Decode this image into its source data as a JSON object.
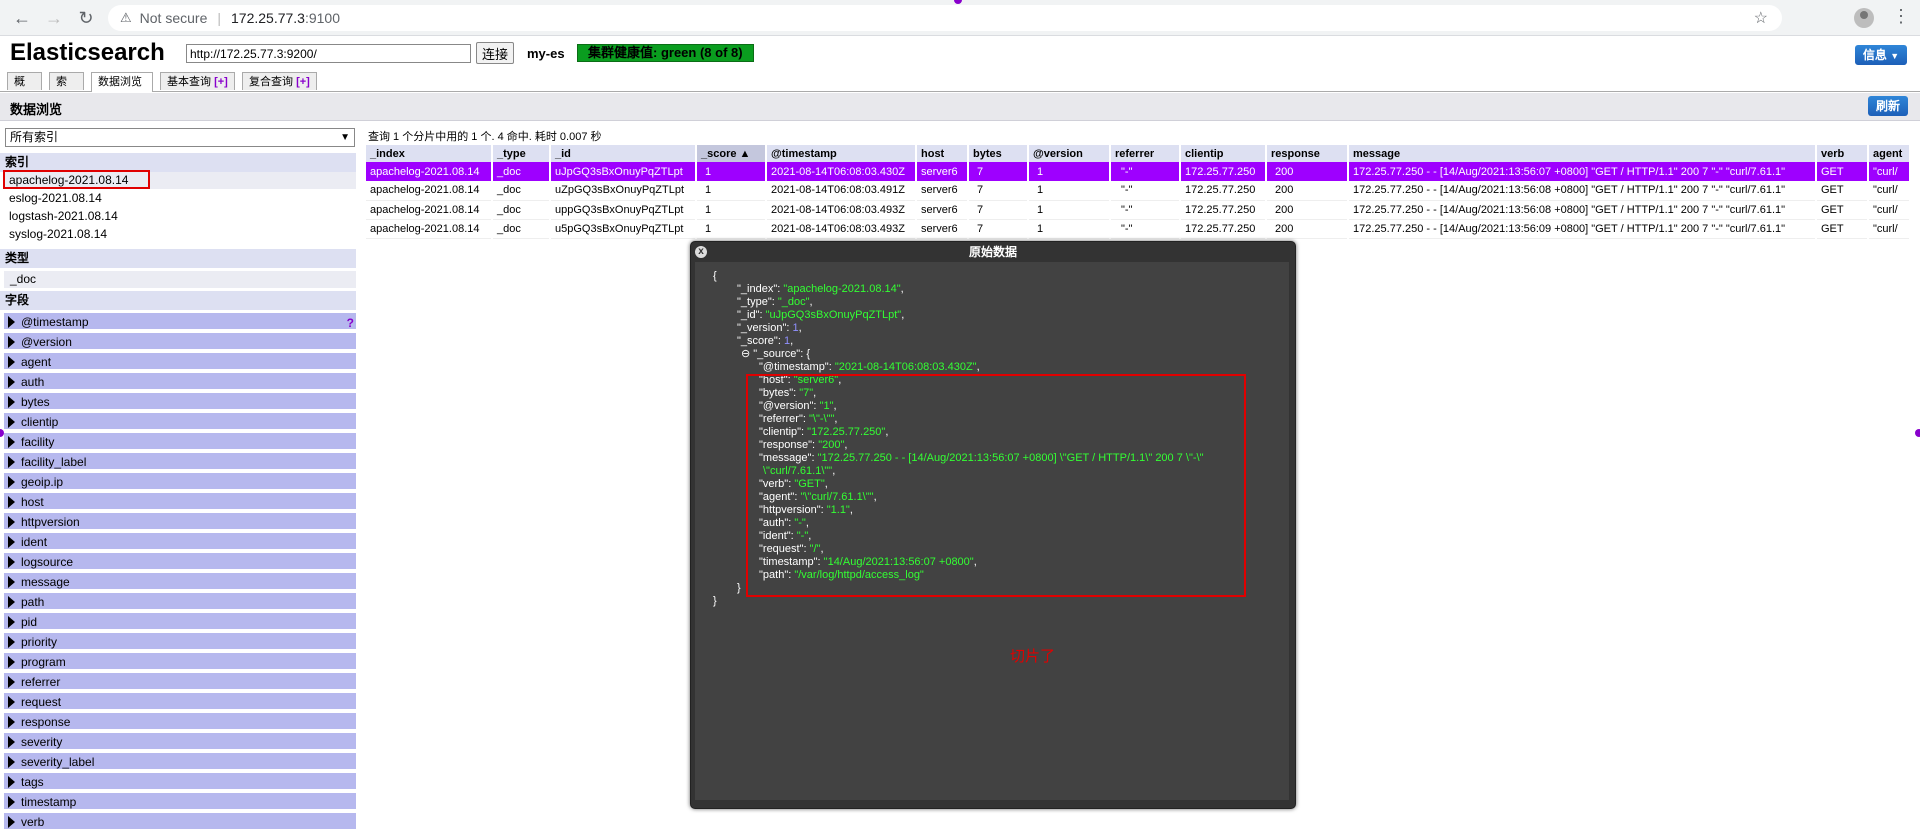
{
  "browser": {
    "security": "Not secure",
    "url_host": "172.25.77.3",
    "url_port": ":9100"
  },
  "header": {
    "title": "Elasticsearch",
    "cluster_url": "http://172.25.77.3:9200/",
    "connect_label": "连接",
    "cluster_name": "my-es",
    "cluster_health": "集群健康值: green (8 of 8)",
    "info_label": "信息"
  },
  "tabs": [
    {
      "label": "概览"
    },
    {
      "label": "索引"
    },
    {
      "label": "数据浏览"
    },
    {
      "label": "基本查询 ",
      "plus": "[+]"
    },
    {
      "label": "复合查询 ",
      "plus": "[+]"
    }
  ],
  "page": {
    "heading": "数据浏览",
    "refresh_label": "刷新"
  },
  "sidebar": {
    "index_select_value": "所有索引",
    "indices_header": "索引",
    "indices": [
      "apachelog-2021.08.14",
      "eslog-2021.08.14",
      "logstash-2021.08.14",
      "syslog-2021.08.14"
    ],
    "types_header": "类型",
    "types": [
      "_doc"
    ],
    "fields_header": "字段",
    "fields": [
      "@timestamp",
      "@version",
      "agent",
      "auth",
      "bytes",
      "clientip",
      "facility",
      "facility_label",
      "geoip.ip",
      "host",
      "httpversion",
      "ident",
      "logsource",
      "message",
      "path",
      "pid",
      "priority",
      "program",
      "referrer",
      "request",
      "response",
      "severity",
      "severity_label",
      "tags",
      "timestamp",
      "verb"
    ],
    "help_mark": "?"
  },
  "results": {
    "summary": "查询 1 个分片中用的 1 个. 4 命中. 耗时 0.007 秒",
    "columns": [
      "_index",
      "_type",
      "_id",
      "_score ▲",
      "@timestamp",
      "host",
      "bytes",
      "@version",
      "referrer",
      "clientip",
      "response",
      "message",
      "verb",
      "agent"
    ],
    "rows": [
      [
        "apachelog-2021.08.14",
        "_doc",
        "uJpGQ3sBxOnuyPqZTLpt",
        "1",
        "2021-08-14T06:08:03.430Z",
        "server6",
        "7",
        "1",
        "\"-\"",
        "172.25.77.250",
        "200",
        "172.25.77.250 - - [14/Aug/2021:13:56:07 +0800] \"GET / HTTP/1.1\" 200 7 \"-\" \"curl/7.61.1\"",
        "GET",
        "\"curl/"
      ],
      [
        "apachelog-2021.08.14",
        "_doc",
        "uZpGQ3sBxOnuyPqZTLpt",
        "1",
        "2021-08-14T06:08:03.491Z",
        "server6",
        "7",
        "1",
        "\"-\"",
        "172.25.77.250",
        "200",
        "172.25.77.250 - - [14/Aug/2021:13:56:08 +0800] \"GET / HTTP/1.1\" 200 7 \"-\" \"curl/7.61.1\"",
        "GET",
        "\"curl/"
      ],
      [
        "apachelog-2021.08.14",
        "_doc",
        "uppGQ3sBxOnuyPqZTLpt",
        "1",
        "2021-08-14T06:08:03.493Z",
        "server6",
        "7",
        "1",
        "\"-\"",
        "172.25.77.250",
        "200",
        "172.25.77.250 - - [14/Aug/2021:13:56:08 +0800] \"GET / HTTP/1.1\" 200 7 \"-\" \"curl/7.61.1\"",
        "GET",
        "\"curl/"
      ],
      [
        "apachelog-2021.08.14",
        "_doc",
        "u5pGQ3sBxOnuyPqZTLpt",
        "1",
        "2021-08-14T06:08:03.493Z",
        "server6",
        "7",
        "1",
        "\"-\"",
        "172.25.77.250",
        "200",
        "172.25.77.250 - - [14/Aug/2021:13:56:09 +0800] \"GET / HTTP/1.1\" 200 7 \"-\" \"curl/7.61.1\"",
        "GET",
        "\"curl/"
      ]
    ]
  },
  "modal": {
    "title": "原始数据",
    "close_glyph": "x",
    "note": "切片了",
    "json_lines": [
      [
        {
          "t": "{",
          "c": "k"
        }
      ],
      [
        {
          "t": "\"_index\": ",
          "c": "k"
        },
        {
          "t": "\"apachelog-2021.08.14\"",
          "c": "s"
        },
        {
          "t": ",",
          "c": "k"
        }
      ],
      [
        {
          "t": "\"_type\": ",
          "c": "k"
        },
        {
          "t": "\"_doc\"",
          "c": "s"
        },
        {
          "t": ",",
          "c": "k"
        }
      ],
      [
        {
          "t": "\"_id\": ",
          "c": "k"
        },
        {
          "t": "\"uJpGQ3sBxOnuyPqZTLpt\"",
          "c": "s"
        },
        {
          "t": ",",
          "c": "k"
        }
      ],
      [
        {
          "t": "\"_version\": ",
          "c": "k"
        },
        {
          "t": "1",
          "c": "n"
        },
        {
          "t": ",",
          "c": "k"
        }
      ],
      [
        {
          "t": "\"_score\": ",
          "c": "k"
        },
        {
          "t": "1",
          "c": "n"
        },
        {
          "t": ",",
          "c": "k"
        }
      ],
      [
        {
          "t": "⊖ \"_source\": {",
          "c": "k"
        }
      ],
      [
        {
          "t": "\"@timestamp\": ",
          "c": "k"
        },
        {
          "t": "\"2021-08-14T06:08:03.430Z\"",
          "c": "s"
        },
        {
          "t": ",",
          "c": "k"
        }
      ],
      [
        {
          "t": "\"host\": ",
          "c": "k"
        },
        {
          "t": "\"server6\"",
          "c": "s"
        },
        {
          "t": ",",
          "c": "k"
        }
      ],
      [
        {
          "t": "\"bytes\": ",
          "c": "k"
        },
        {
          "t": "\"7\"",
          "c": "s"
        },
        {
          "t": ",",
          "c": "k"
        }
      ],
      [
        {
          "t": "\"@version\": ",
          "c": "k"
        },
        {
          "t": "\"1\"",
          "c": "s"
        },
        {
          "t": ",",
          "c": "k"
        }
      ],
      [
        {
          "t": "\"referrer\": ",
          "c": "k"
        },
        {
          "t": "\"\\\"-\\\"\"",
          "c": "s"
        },
        {
          "t": ",",
          "c": "k"
        }
      ],
      [
        {
          "t": "\"clientip\": ",
          "c": "k"
        },
        {
          "t": "\"172.25.77.250\"",
          "c": "s"
        },
        {
          "t": ",",
          "c": "k"
        }
      ],
      [
        {
          "t": "\"response\": ",
          "c": "k"
        },
        {
          "t": "\"200\"",
          "c": "s"
        },
        {
          "t": ",",
          "c": "k"
        }
      ],
      [
        {
          "t": "\"message\": ",
          "c": "k"
        },
        {
          "t": "\"172.25.77.250 - - [14/Aug/2021:13:56:07 +0800] \\\"GET / HTTP/1.1\\\" 200 7 \\\"-\\\"",
          "c": "s"
        }
      ],
      [
        {
          "t": "\\\"curl/7.61.1\\\"\"",
          "c": "s"
        },
        {
          "t": ",",
          "c": "k"
        }
      ],
      [
        {
          "t": "\"verb\": ",
          "c": "k"
        },
        {
          "t": "\"GET\"",
          "c": "s"
        },
        {
          "t": ",",
          "c": "k"
        }
      ],
      [
        {
          "t": "\"agent\": ",
          "c": "k"
        },
        {
          "t": "\"\\\"curl/7.61.1\\\"\"",
          "c": "s"
        },
        {
          "t": ",",
          "c": "k"
        }
      ],
      [
        {
          "t": "\"httpversion\": ",
          "c": "k"
        },
        {
          "t": "\"1.1\"",
          "c": "s"
        },
        {
          "t": ",",
          "c": "k"
        }
      ],
      [
        {
          "t": "\"auth\": ",
          "c": "k"
        },
        {
          "t": "\"-\"",
          "c": "s"
        },
        {
          "t": ",",
          "c": "k"
        }
      ],
      [
        {
          "t": "\"ident\": ",
          "c": "k"
        },
        {
          "t": "\"-\"",
          "c": "s"
        },
        {
          "t": ",",
          "c": "k"
        }
      ],
      [
        {
          "t": "\"request\": ",
          "c": "k"
        },
        {
          "t": "\"/\"",
          "c": "s"
        },
        {
          "t": ",",
          "c": "k"
        }
      ],
      [
        {
          "t": "\"timestamp\": ",
          "c": "k"
        },
        {
          "t": "\"14/Aug/2021:13:56:07 +0800\"",
          "c": "s"
        },
        {
          "t": ",",
          "c": "k"
        }
      ],
      [
        {
          "t": "\"path\": ",
          "c": "k"
        },
        {
          "t": "\"/var/log/httpd/access_log\"",
          "c": "s"
        }
      ],
      [
        {
          "t": "}",
          "c": "k"
        }
      ],
      [
        {
          "t": "}",
          "c": "k"
        }
      ]
    ]
  }
}
